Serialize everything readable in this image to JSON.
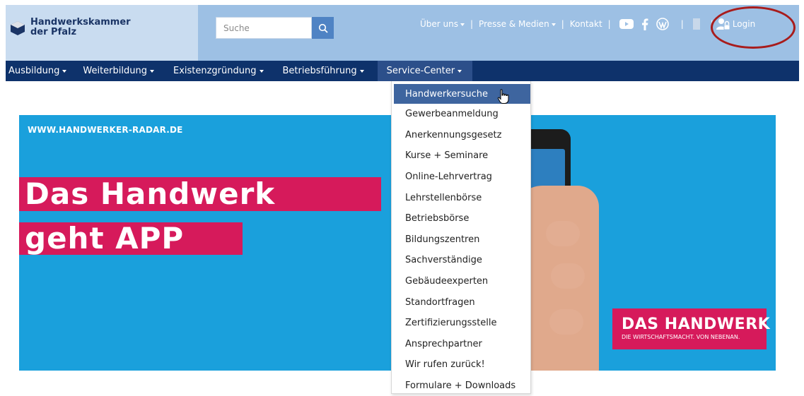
{
  "header": {
    "logo_line1": "Handwerkskammer",
    "logo_line2": "der Pfalz",
    "search_placeholder": "Suche",
    "top_links": [
      {
        "label": "Über uns",
        "has_caret": true
      },
      {
        "label": "Presse & Medien",
        "has_caret": true
      },
      {
        "label": "Kontakt",
        "has_caret": false
      }
    ],
    "social_icons": [
      "youtube-icon",
      "facebook-icon",
      "wordpress-icon",
      "instagram-icon"
    ],
    "login_label": "Login"
  },
  "mainnav": {
    "items": [
      {
        "label": "Ausbildung"
      },
      {
        "label": "Weiterbildung"
      },
      {
        "label": "Existenzgründung"
      },
      {
        "label": "Betriebsführung"
      },
      {
        "label": "Service-Center"
      }
    ],
    "active_item": "Service-Center"
  },
  "dropdown": {
    "items": [
      "Handwerkersuche",
      "Gewerbeanmeldung",
      "Anerkennungsgesetz",
      "Kurse + Seminare",
      "Online-Lehrvertrag",
      "Lehrstellenbörse",
      "Betriebsbörse",
      "Bildungszentren",
      "Sachverständige",
      "Gebäudeexperten",
      "Standortfragen",
      "Zertifizierungsstelle",
      "Ansprechpartner",
      "Wir rufen zurück!",
      "Formulare + Downloads"
    ],
    "hovered_item": "Handwerkersuche"
  },
  "banner": {
    "url_text": "WWW.HANDWERKER-RADAR.DE",
    "headline_line1": "Das Handwerk",
    "headline_line2": "geht APP",
    "brand_main": "DAS HANDWERK",
    "brand_sub": "DIE WIRTSCHAFTSMACHT. VON NEBENAN."
  },
  "colors": {
    "header_bg": "#9dc0e4",
    "logo_bg": "#c9dcf0",
    "nav_bg": "#0e326b",
    "banner_bg": "#1aa0dc",
    "accent_pink": "#d61a5b",
    "dropdown_hover": "#3e659f",
    "annotation_ring": "#a81c1c"
  }
}
